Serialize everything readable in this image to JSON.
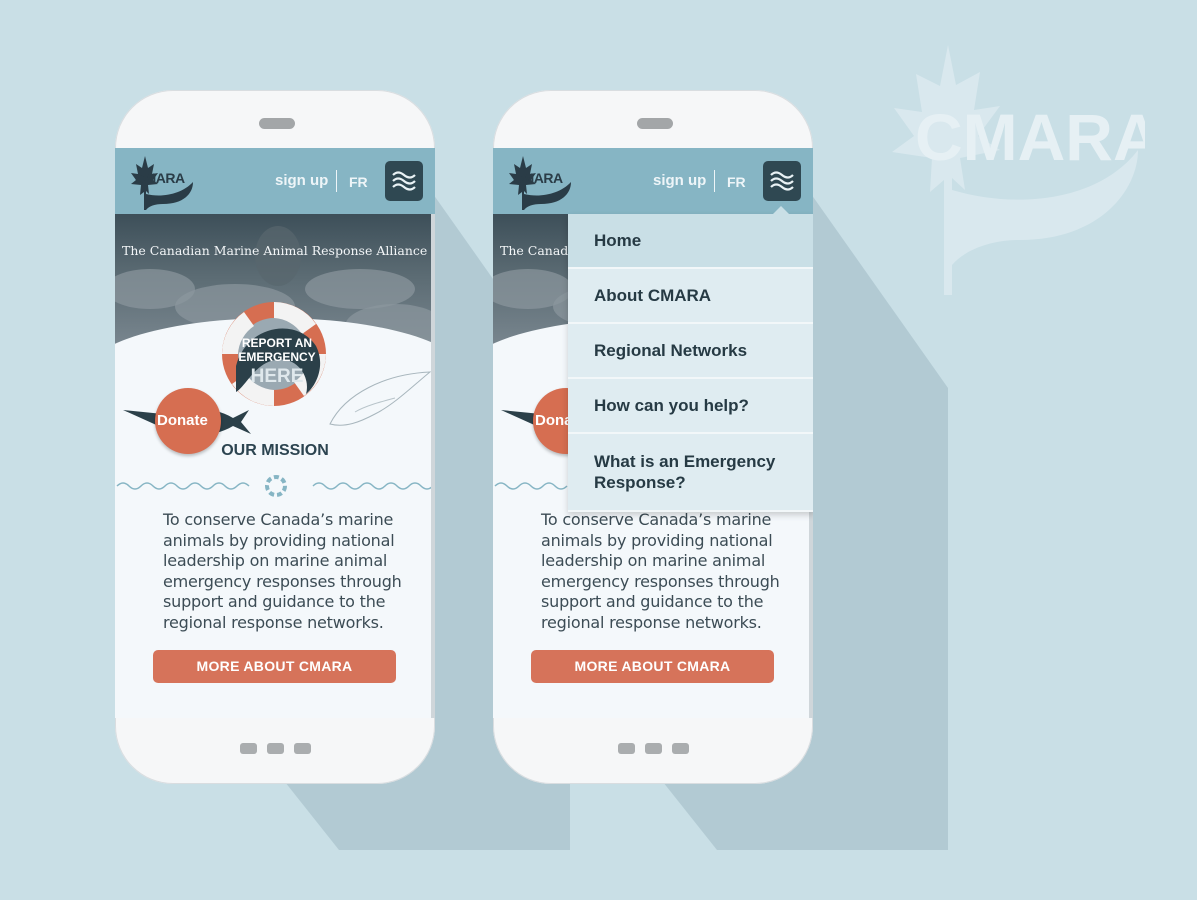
{
  "brand": {
    "logo_text": "CMARA",
    "watermark_text": "CMARA",
    "colors": {
      "background": "#c9dfe6",
      "header": "#86b5c4",
      "accent": "#d66e51",
      "dark": "#2f4852"
    }
  },
  "header": {
    "signup_label": "sign up",
    "lang_label": "FR",
    "menu_icon": "waves-menu-icon"
  },
  "hero": {
    "tagline": "The Canadian Marine Animal Response Alliance",
    "report_line1": "REPORT AN",
    "report_line2": "EMERGENCY",
    "report_here": "HERE"
  },
  "donate": {
    "label": "Donate"
  },
  "mission": {
    "title": "OUR MISSION",
    "lines": [
      "To conserve Canada’s marine",
      "animals by providing national",
      "leadership on marine animal",
      "emergency responses through",
      "support and guidance to the",
      "regional response networks."
    ],
    "button_label": "MORE ABOUT CMARA"
  },
  "menu": {
    "items": [
      {
        "label": "Home"
      },
      {
        "label": "About CMARA"
      },
      {
        "label": "Regional Networks"
      },
      {
        "label": "How can you help?"
      },
      {
        "label_line1": "What is an Emergency",
        "label_line2": "Response?"
      }
    ]
  }
}
